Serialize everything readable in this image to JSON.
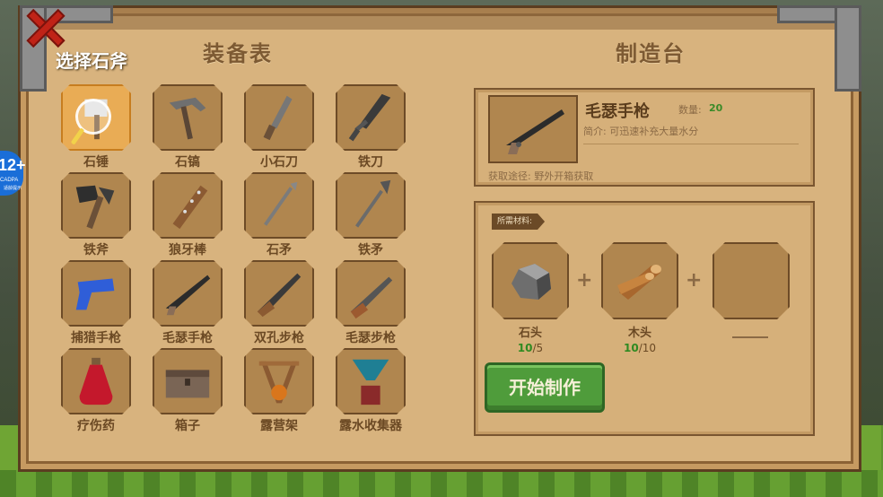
{
  "titles": {
    "equipment": "装备表",
    "crafting": "制造台"
  },
  "hint": "选择石斧",
  "side_badge": {
    "age": "12+",
    "sub": "CADPA",
    "sub2": "适龄提示"
  },
  "items": [
    {
      "label": "石锤",
      "icon": "stone-hammer-icon",
      "selected": true
    },
    {
      "label": "石镐",
      "icon": "stone-pickaxe-icon"
    },
    {
      "label": "小石刀",
      "icon": "small-stone-knife-icon"
    },
    {
      "label": "铁刀",
      "icon": "iron-sword-icon"
    },
    {
      "label": "铁斧",
      "icon": "iron-axe-icon"
    },
    {
      "label": "狼牙棒",
      "icon": "spiked-club-icon"
    },
    {
      "label": "石矛",
      "icon": "stone-spear-icon"
    },
    {
      "label": "铁矛",
      "icon": "iron-spear-icon"
    },
    {
      "label": "捕猎手枪",
      "icon": "hunting-pistol-icon"
    },
    {
      "label": "毛瑟手枪",
      "icon": "mauser-pistol-icon"
    },
    {
      "label": "双孔步枪",
      "icon": "double-barrel-rifle-icon"
    },
    {
      "label": "毛瑟步枪",
      "icon": "mauser-rifle-icon"
    },
    {
      "label": "疗伤药",
      "icon": "healing-potion-icon"
    },
    {
      "label": "箱子",
      "icon": "chest-icon"
    },
    {
      "label": "露营架",
      "icon": "campfire-rack-icon"
    },
    {
      "label": "露水收集器",
      "icon": "dew-collector-icon"
    }
  ],
  "detail": {
    "name": "毛瑟手枪",
    "qty_label": "数量:",
    "qty_value": "20",
    "desc": "简介: 可迅速补充大量水分",
    "source": "获取途径: 野外开箱获取"
  },
  "materials": {
    "tag": "所需材料:",
    "list": [
      {
        "name": "石头",
        "have": "10",
        "need": "5",
        "icon": "stone-icon"
      },
      {
        "name": "木头",
        "have": "10",
        "need": "10",
        "icon": "wood-icon"
      }
    ],
    "plus": "+"
  },
  "craft_button": "开始制作",
  "colors": {
    "panel": "#d8b37e",
    "slot": "#b0864f",
    "selected": "#e9ac55",
    "button": "#4f9c3b",
    "close": "#c02317"
  }
}
